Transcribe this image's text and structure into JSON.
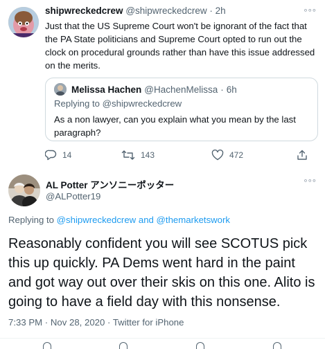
{
  "tweet1": {
    "name": "shipwreckedcrew",
    "handle": "@shipwreckedcrew",
    "time": "2h",
    "more": "°°°",
    "text": "Just that the US Supreme Court won't be ignorant of the fact that the PA State politicians and Supreme Court opted to run out the clock on procedural grounds rather than have this issue addressed on the merits.",
    "quote": {
      "name": "Melissa Hachen",
      "handle": "@HachenMelissa",
      "time": "6h",
      "replying_prefix": "Replying to",
      "replying_to": "@shipwreckedcrew",
      "text": "As a non lawyer, can you explain what you mean by the last paragraph?"
    },
    "actions": {
      "replies": "14",
      "retweets": "143",
      "likes": "472"
    }
  },
  "tweet2": {
    "name": "AL Potter アンソニーポッター",
    "handle": "@ALPotter19",
    "more": "°°°",
    "replying_prefix": "Replying to",
    "replying_to_1": "@shipwreckedcrew",
    "replying_and": "and",
    "replying_to_2": "@themarketswork",
    "text": "Reasonably confident you will see SCOTUS pick this up quickly. PA Dems went hard in the paint and got way out over their skis on this one. Alito is going to have a field day with this nonsense.",
    "time": "7:33 PM",
    "date": "Nov 28, 2020",
    "source": "Twitter for iPhone"
  },
  "colors": {
    "link": "#1d9bf0",
    "muted": "#536471",
    "text": "#0f1419",
    "border": "#cfd9de"
  }
}
